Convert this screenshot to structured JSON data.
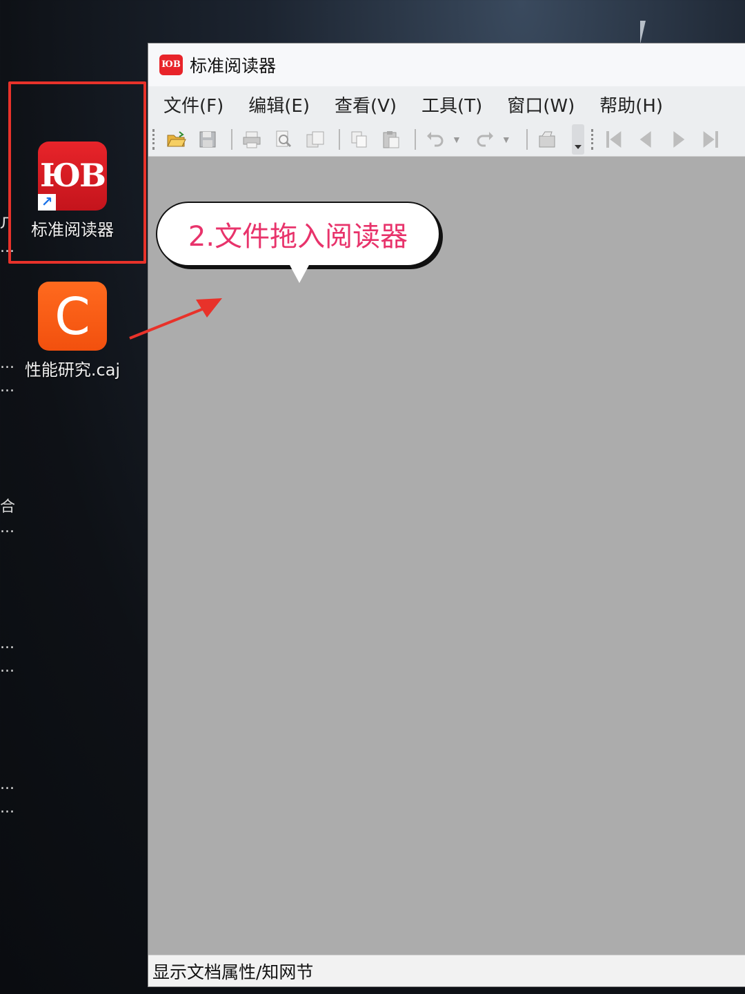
{
  "desktop": {
    "icons": [
      {
        "label": "标准阅读器",
        "icon": "standard-reader-icon",
        "color": "#e8242a",
        "logo_text": "ЮB"
      },
      {
        "label": "性能研究.caj",
        "icon": "caj-file-icon",
        "color": "#ff6a1e",
        "logo_text": "C"
      }
    ],
    "edge_glyphs": [
      "Л",
      "...",
      "...",
      "...",
      "合",
      "...",
      "...",
      "...",
      "...",
      "..."
    ],
    "highlight_color": "#e8322a"
  },
  "window": {
    "title": "标准阅读器",
    "title_logo_text": "ЮB",
    "menu": [
      {
        "label": "文件(F)"
      },
      {
        "label": "编辑(E)"
      },
      {
        "label": "查看(V)"
      },
      {
        "label": "工具(T)"
      },
      {
        "label": "窗口(W)"
      },
      {
        "label": "帮助(H)"
      }
    ],
    "toolbar_icons": [
      "open-folder-icon",
      "save-icon",
      "print-icon",
      "print-preview-icon",
      "snapshot-icon",
      "copy-icon",
      "paste-icon",
      "undo-icon",
      "redo-icon",
      "properties-icon",
      "first-page-icon",
      "prev-page-icon",
      "next-page-icon",
      "last-page-icon"
    ],
    "document_bg": "#acacac",
    "status": "显示文档属性/知网节"
  },
  "callout": {
    "text": "2.文件拖入阅读器",
    "text_color": "#e8336b"
  }
}
